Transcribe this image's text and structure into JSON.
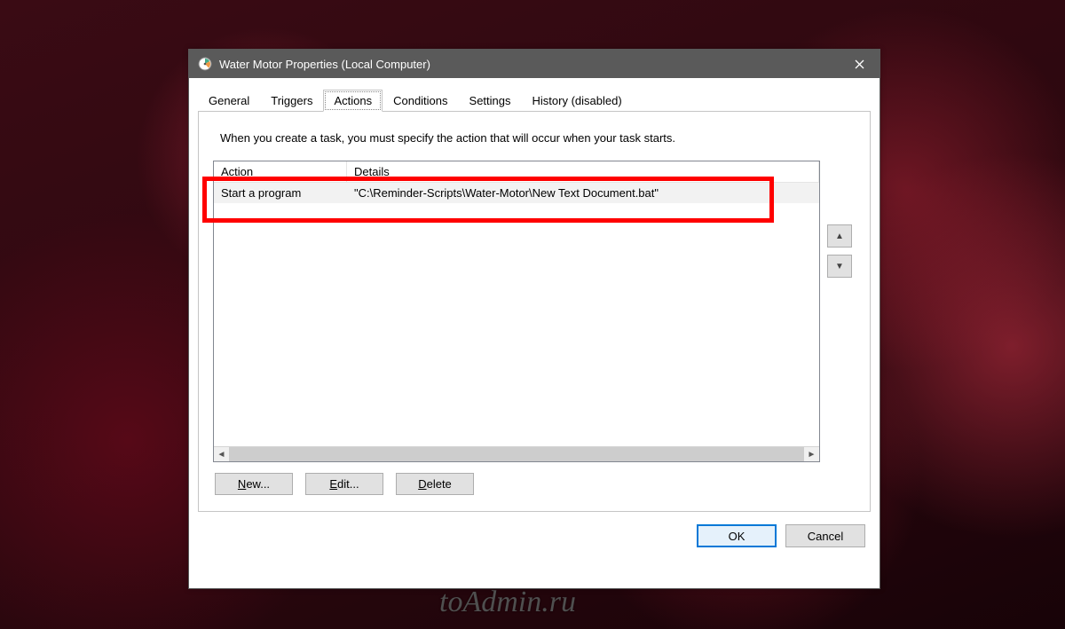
{
  "window": {
    "title": "Water Motor Properties (Local Computer)"
  },
  "tabs": [
    {
      "label": "General"
    },
    {
      "label": "Triggers"
    },
    {
      "label": "Actions"
    },
    {
      "label": "Conditions"
    },
    {
      "label": "Settings"
    },
    {
      "label": "History (disabled)"
    }
  ],
  "active_tab_index": 2,
  "instruction": "When you create a task, you must specify the action that will occur when your task starts.",
  "columns": {
    "action": "Action",
    "details": "Details"
  },
  "rows": [
    {
      "action": "Start a program",
      "details": "\"C:\\Reminder-Scripts\\Water-Motor\\New Text Document.bat\""
    }
  ],
  "buttons": {
    "new": "New...",
    "edit": "Edit...",
    "delete": "Delete",
    "ok": "OK",
    "cancel": "Cancel"
  },
  "watermark": "toAdmin.ru"
}
